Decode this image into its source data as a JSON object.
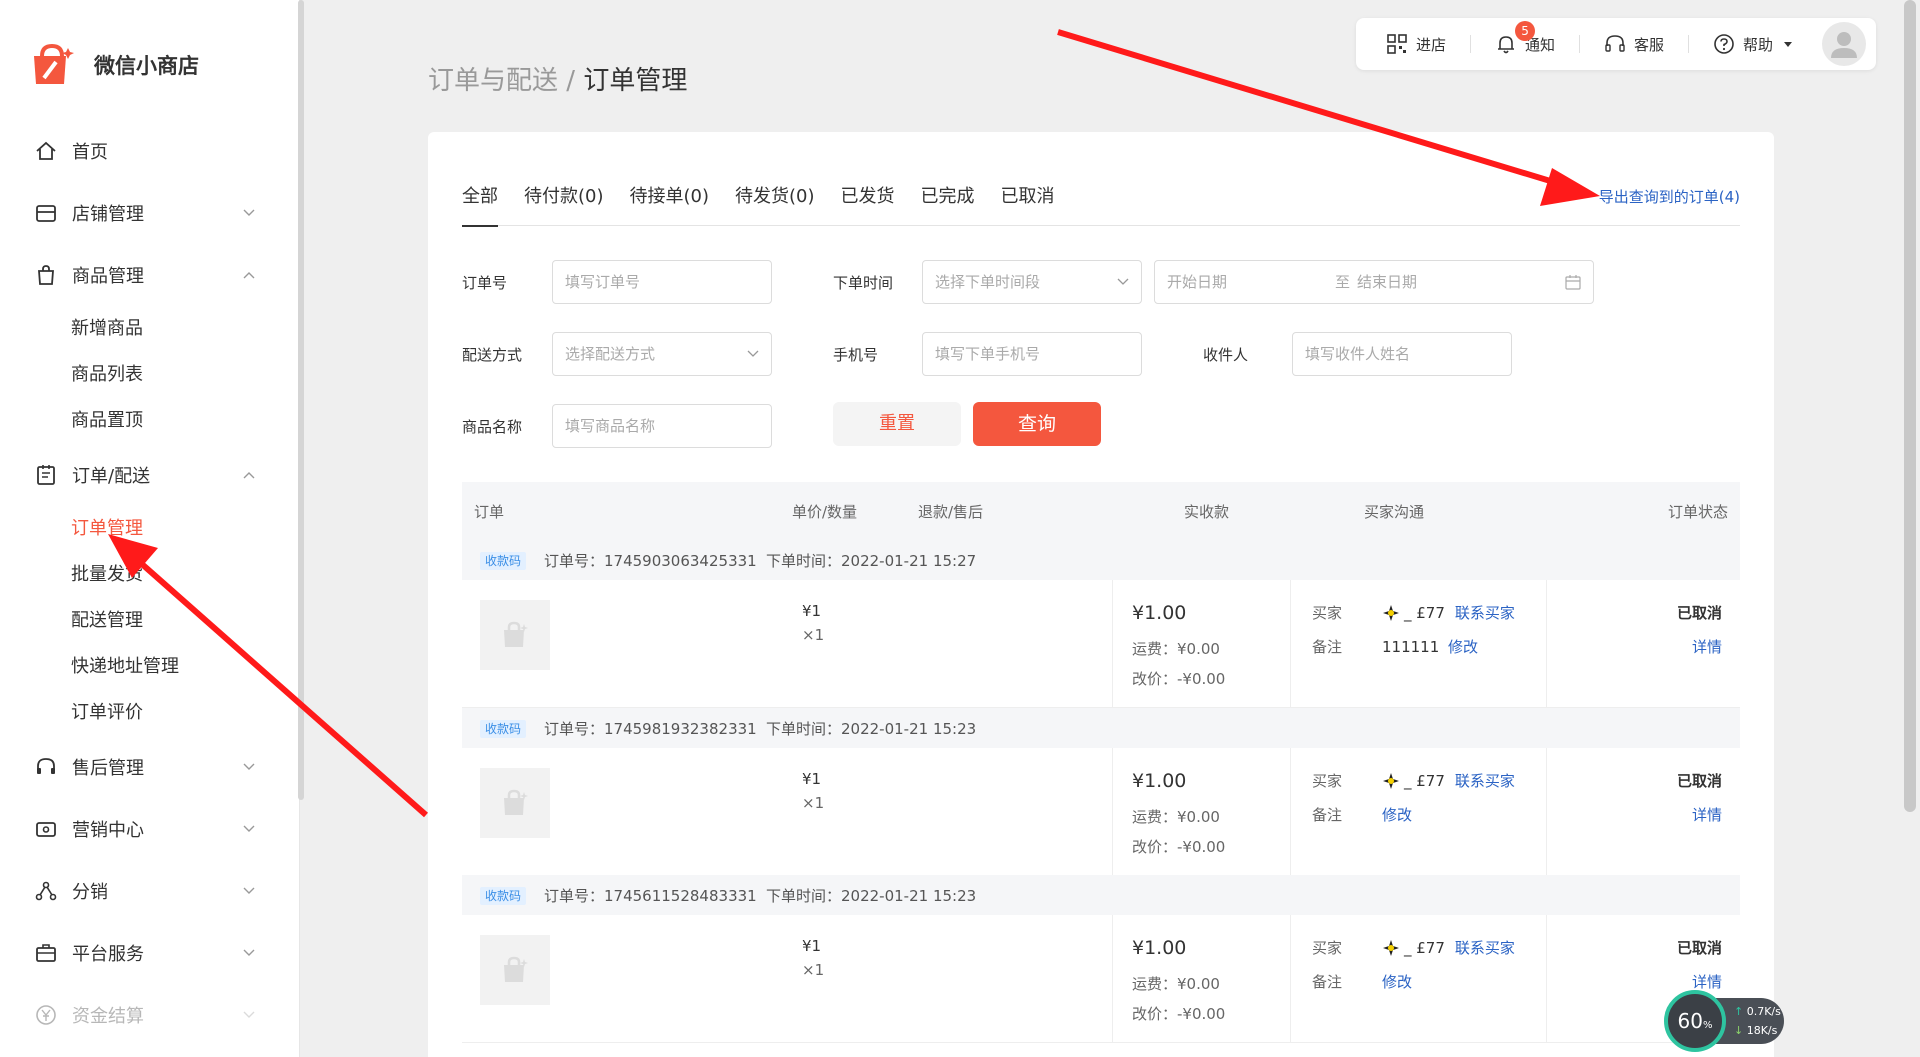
{
  "app": {
    "brand": "微信小商店"
  },
  "colors": {
    "accent": "#f4573e",
    "link": "#2b63c4",
    "arrow": "#ff1a1a"
  },
  "sidebar": {
    "items": [
      {
        "label": "首页",
        "icon": "home-icon"
      },
      {
        "label": "店铺管理",
        "icon": "store-icon"
      },
      {
        "label": "商品管理",
        "icon": "shopping-bag-icon",
        "sub": [
          "新增商品",
          "商品列表",
          "商品置顶"
        ]
      },
      {
        "label": "订单/配送",
        "icon": "clipboard-icon",
        "sub": [
          "订单管理",
          "批量发货",
          "配送管理",
          "快递地址管理",
          "订单评价"
        ],
        "active_sub": "订单管理"
      },
      {
        "label": "售后管理",
        "icon": "headset-icon"
      },
      {
        "label": "营销中心",
        "icon": "ticket-icon"
      },
      {
        "label": "分销",
        "icon": "share-nodes-icon"
      },
      {
        "label": "平台服务",
        "icon": "briefcase-icon"
      },
      {
        "label": "资金结算",
        "icon": "yen-circle-icon"
      }
    ]
  },
  "header": {
    "breadcrumb_parent": "订单与配送",
    "breadcrumb_sep": "/",
    "breadcrumb_current": "订单管理",
    "topbar": {
      "store": "进店",
      "notify": "通知",
      "notify_count": "5",
      "service": "客服",
      "help": "帮助"
    }
  },
  "tabs": [
    "全部",
    "待付款(0)",
    "待接单(0)",
    "待发货(0)",
    "已发货",
    "已完成",
    "已取消"
  ],
  "export_label": "导出查询到的订单(4)",
  "filters": {
    "order_no": {
      "label": "订单号",
      "placeholder": "填写订单号"
    },
    "order_time": {
      "label": "下单时间",
      "placeholder": "选择下单时间段",
      "start": "开始日期",
      "to": "至",
      "end": "结束日期"
    },
    "delivery": {
      "label": "配送方式",
      "placeholder": "选择配送方式"
    },
    "phone": {
      "label": "手机号",
      "placeholder": "填写下单手机号"
    },
    "receiver": {
      "label": "收件人",
      "placeholder": "填写收件人姓名"
    },
    "product": {
      "label": "商品名称",
      "placeholder": "填写商品名称"
    },
    "reset": "重置",
    "query": "查询"
  },
  "table": {
    "headers": [
      "订单",
      "单价/数量",
      "退款/售后",
      "实收款",
      "买家沟通",
      "订单状态"
    ]
  },
  "orders": [
    {
      "tag": "收款码",
      "order_no": "订单号：1745903063425331",
      "time": "下单时间：2022-01-21 15:27",
      "price": "¥1",
      "qty": "×1",
      "amount": "¥1.00",
      "ship": "运费：¥0.00",
      "change": "改价：-¥0.00",
      "buyer_label": "买家",
      "buyer": "_ £77",
      "contact": "联系买家",
      "note_label": "备注",
      "note": "111111",
      "edit": "修改",
      "status": "已取消",
      "detail": "详情"
    },
    {
      "tag": "收款码",
      "order_no": "订单号：1745981932382331",
      "time": "下单时间：2022-01-21 15:23",
      "price": "¥1",
      "qty": "×1",
      "amount": "¥1.00",
      "ship": "运费：¥0.00",
      "change": "改价：-¥0.00",
      "buyer_label": "买家",
      "buyer": "_ £77",
      "contact": "联系买家",
      "note_label": "备注",
      "note": "",
      "edit": "修改",
      "status": "已取消",
      "detail": "详情"
    },
    {
      "tag": "收款码",
      "order_no": "订单号：1745611528483331",
      "time": "下单时间：2022-01-21 15:23",
      "price": "¥1",
      "qty": "×1",
      "amount": "¥1.00",
      "ship": "运费：¥0.00",
      "change": "改价：-¥0.00",
      "buyer_label": "买家",
      "buyer": "_ £77",
      "contact": "联系买家",
      "note_label": "备注",
      "note": "",
      "edit": "修改",
      "status": "已取消",
      "detail": "详情"
    }
  ],
  "speed_widget": {
    "percent": "60",
    "percent_unit": "%",
    "up": "0.7",
    "down": "18",
    "unit": "K/s"
  }
}
